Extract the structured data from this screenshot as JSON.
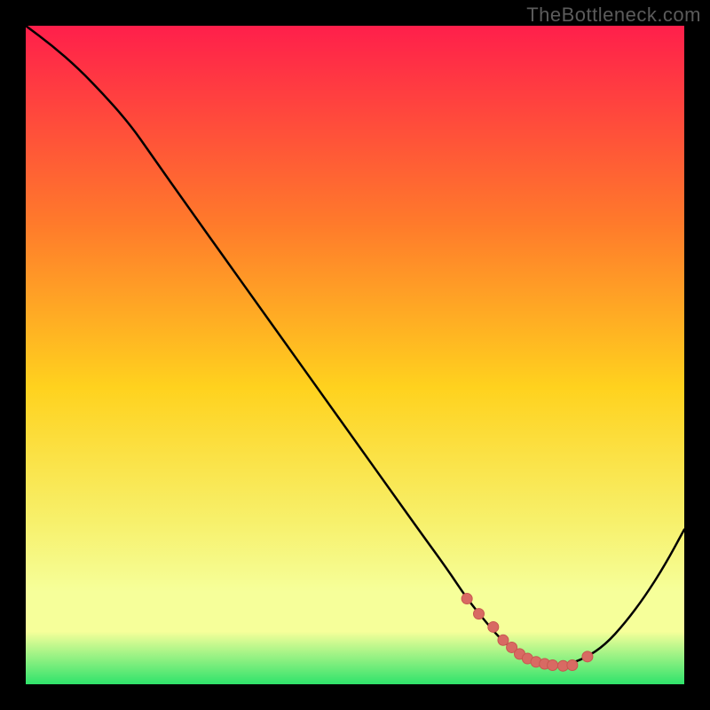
{
  "watermark": "TheBottleneck.com",
  "colors": {
    "frame_bg": "#000000",
    "gradient_top": "#ff1f4b",
    "gradient_mid_upper": "#ff7a2b",
    "gradient_mid": "#ffd21e",
    "gradient_lower": "#f7f06a",
    "gradient_band": "#f6ff9a",
    "gradient_bottom": "#2fe36b",
    "curve": "#000000",
    "marker_fill": "#d86a63",
    "marker_stroke": "#c85750"
  },
  "chart_data": {
    "type": "line",
    "title": "",
    "xlabel": "",
    "ylabel": "",
    "xlim": [
      0,
      100
    ],
    "ylim": [
      0,
      100
    ],
    "series": [
      {
        "name": "bottleneck-curve",
        "x": [
          0,
          4,
          8,
          12,
          16,
          19,
          25,
          30,
          35,
          40,
          45,
          50,
          55,
          60,
          64,
          67,
          70,
          72,
          74,
          76,
          78,
          80,
          82,
          85,
          88,
          91,
          94,
          97,
          100
        ],
        "y": [
          100,
          97,
          93.5,
          89.4,
          84.8,
          80.5,
          72,
          65,
          58,
          51,
          44,
          37,
          30,
          23,
          17.5,
          13,
          9.3,
          7,
          5.3,
          4,
          3.1,
          2.7,
          2.9,
          4,
          6,
          9.3,
          13.3,
          18,
          23.5
        ]
      }
    ],
    "markers": {
      "name": "highlighted-range",
      "x": [
        67,
        68.8,
        71,
        72.5,
        73.8,
        75,
        76.2,
        77.5,
        78.8,
        80,
        81.6,
        83,
        85.3
      ],
      "y": [
        13,
        10.7,
        8.7,
        6.7,
        5.6,
        4.6,
        3.9,
        3.4,
        3.1,
        2.9,
        2.8,
        2.9,
        4.2
      ]
    },
    "gradient_stops_pct": [
      0,
      30,
      55,
      75,
      86,
      92,
      100
    ]
  }
}
